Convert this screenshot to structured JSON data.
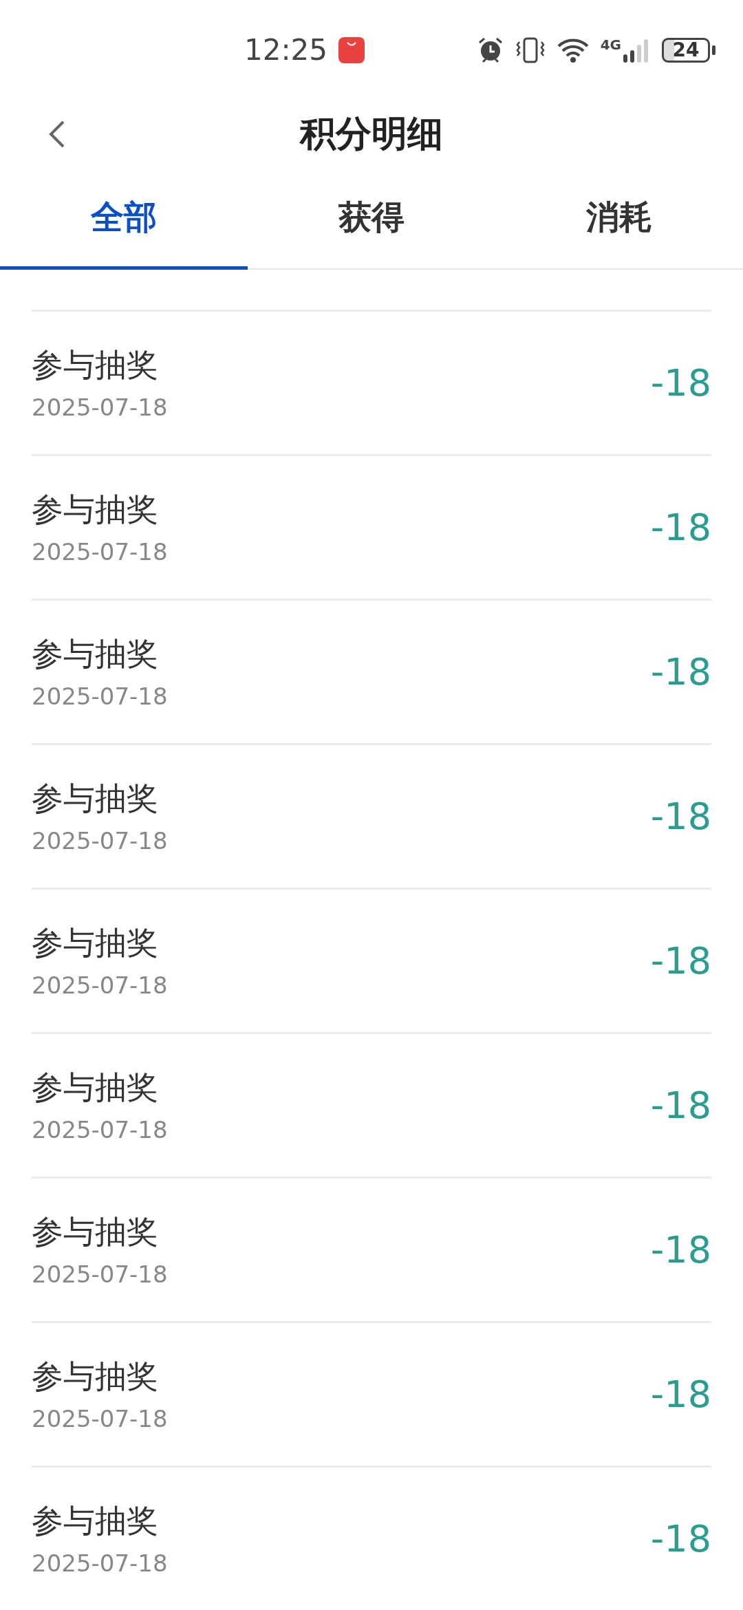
{
  "status_bar": {
    "time": "12:25",
    "network_type": "4G",
    "battery": "24"
  },
  "header": {
    "title": "积分明细"
  },
  "tabs": [
    {
      "label": "全部",
      "selected": true
    },
    {
      "label": "获得",
      "selected": false
    },
    {
      "label": "消耗",
      "selected": false
    }
  ],
  "records": [
    {
      "title": "参与抽奖",
      "date": "2025-07-18",
      "points": "-18"
    },
    {
      "title": "参与抽奖",
      "date": "2025-07-18",
      "points": "-18"
    },
    {
      "title": "参与抽奖",
      "date": "2025-07-18",
      "points": "-18"
    },
    {
      "title": "参与抽奖",
      "date": "2025-07-18",
      "points": "-18"
    },
    {
      "title": "参与抽奖",
      "date": "2025-07-18",
      "points": "-18"
    },
    {
      "title": "参与抽奖",
      "date": "2025-07-18",
      "points": "-18"
    },
    {
      "title": "参与抽奖",
      "date": "2025-07-18",
      "points": "-18"
    },
    {
      "title": "参与抽奖",
      "date": "2025-07-18",
      "points": "-18"
    },
    {
      "title": "参与抽奖",
      "date": "2025-07-18",
      "points": "-18"
    }
  ]
}
